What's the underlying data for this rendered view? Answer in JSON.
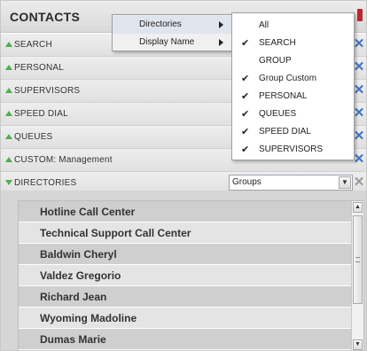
{
  "panel": {
    "title": "CONTACTS",
    "title_marker_color": "#c0262c"
  },
  "sections": [
    {
      "label": "SEARCH",
      "expanded": false,
      "remove": "✕"
    },
    {
      "label": "PERSONAL",
      "expanded": false,
      "remove": "✕"
    },
    {
      "label": "SUPERVISORS",
      "expanded": false,
      "remove": "✕"
    },
    {
      "label": "SPEED DIAL",
      "expanded": false,
      "remove": "✕"
    },
    {
      "label": "QUEUES",
      "expanded": false,
      "remove": "✕"
    },
    {
      "label": "CUSTOM: Management",
      "expanded": false,
      "remove": "✕"
    },
    {
      "label": "DIRECTORIES",
      "expanded": true,
      "remove": "✕"
    }
  ],
  "directory_select": {
    "value": "Groups",
    "arrow": "▼"
  },
  "directory_entries": [
    "Hotline Call Center",
    "Technical Support Call Center",
    "Baldwin Cheryl",
    "Valdez Gregorio",
    "Richard Jean",
    "Wyoming Madoline",
    "Dumas Marie"
  ],
  "context_menu": {
    "items": [
      {
        "label": "Directories",
        "has_submenu": true
      },
      {
        "label": "Display Name",
        "has_submenu": true
      }
    ]
  },
  "submenu": {
    "items": [
      {
        "label": "All",
        "checked": false
      },
      {
        "label": "SEARCH",
        "checked": true
      },
      {
        "label": "GROUP",
        "checked": false
      },
      {
        "label": "Group Custom",
        "checked": true
      },
      {
        "label": "PERSONAL",
        "checked": true
      },
      {
        "label": "QUEUES",
        "checked": true
      },
      {
        "label": "SPEED DIAL",
        "checked": true
      },
      {
        "label": "SUPERVISORS",
        "checked": true
      }
    ],
    "check_glyph": "✔"
  },
  "scrollbar": {
    "up": "▲",
    "down": "▼"
  },
  "colors": {
    "accent_triangle": "#4fae4f",
    "remove_icon": "#3d74c9",
    "remove_icon_disabled": "#9a9a9a"
  }
}
